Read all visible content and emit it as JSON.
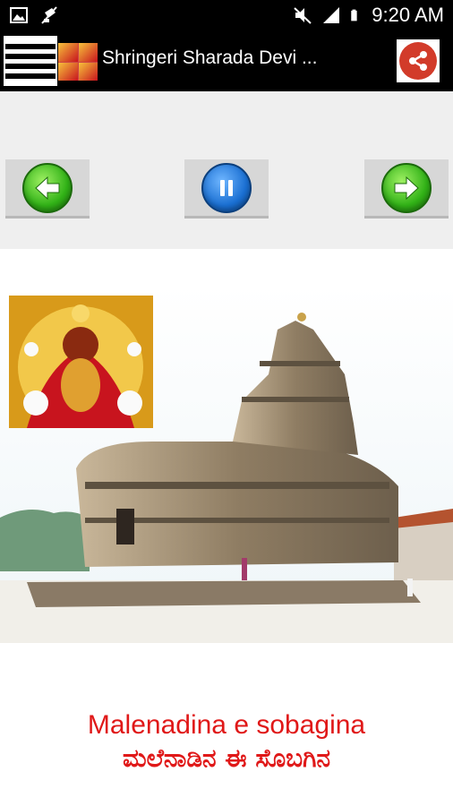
{
  "status_bar": {
    "time": "9:20 AM",
    "icons": [
      "image-icon",
      "no-notification-icon",
      "mute-icon",
      "signal-icon",
      "battery-icon"
    ]
  },
  "app_bar": {
    "title": "Shringeri Sharada Devi ...",
    "icons": [
      "menu-icon",
      "app-logo",
      "share-icon"
    ],
    "share_color": "#d23b2a"
  },
  "controls": {
    "buttons": [
      "previous-button",
      "pause-button",
      "next-button"
    ],
    "green": "#31b217",
    "blue": "#1a6fd2"
  },
  "lyrics": {
    "line1": "Malenadina e sobagina",
    "line2": "ಮಲೆನಾಡಿನ ಈ ಸೊಬಗಿನ",
    "color": "#e01818"
  }
}
